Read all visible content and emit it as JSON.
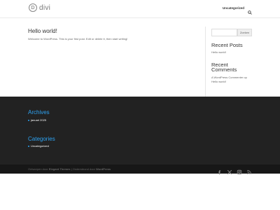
{
  "header": {
    "logo_mark": "D",
    "logo_text": "divi",
    "nav_item": "Uncategorized",
    "search_icon": "search-icon"
  },
  "post": {
    "title": "Hello world!",
    "body": "Welcome to WordPress. This is your first post. Edit or delete it, then start writing!"
  },
  "sidebar": {
    "search_placeholder": "",
    "search_button": "Zoeken",
    "recent_posts_title": "Recent Posts",
    "recent_posts": [
      "Hello world!"
    ],
    "recent_comments_title_line1": "Recent",
    "recent_comments_title_line2": "Comments",
    "recent_comment_line1": "A WordPress Commenter op",
    "recent_comment_line2": "Hello world!"
  },
  "footer": {
    "archives_title": "Archives",
    "archives_item": "januari 2025",
    "categories_title": "Categories",
    "categories_item": "Uncategorized",
    "credits_prefix": "Ontworpen door ",
    "credits_theme": "Elegant Themes",
    "credits_middle": " | Ondersteund door ",
    "credits_wp": "WordPress",
    "social_icons": [
      "facebook-icon",
      "x-icon",
      "instagram-icon",
      "rss-icon"
    ]
  },
  "colors": {
    "accent": "#2ea3f2",
    "footer_bg": "#222222",
    "bottom_bar_bg": "#171717"
  }
}
